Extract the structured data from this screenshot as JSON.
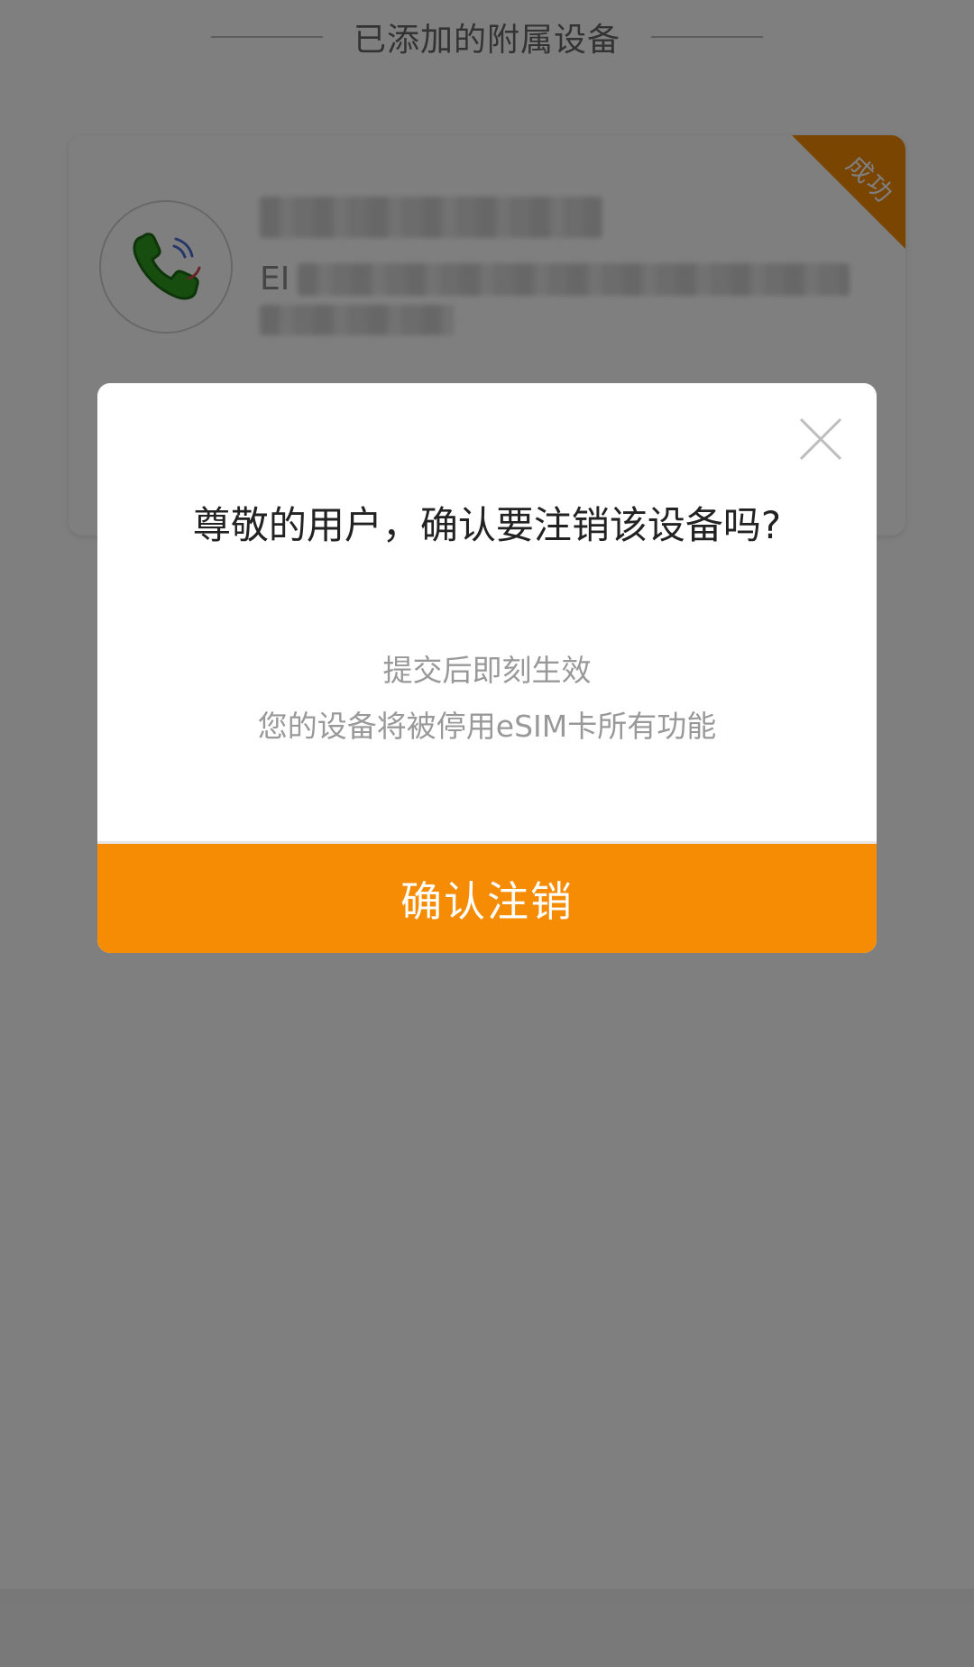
{
  "section": {
    "title": "已添加的附属设备"
  },
  "device_card": {
    "name": "",
    "eid_prefix": "EI",
    "status_badge": "成功"
  },
  "dialog": {
    "title": "尊敬的用户，确认要注销该设备吗?",
    "desc_line1": "提交后即刻生效",
    "desc_line2": "您的设备将被停用eSIM卡所有功能",
    "confirm_label": "确认注销"
  },
  "colors": {
    "accent": "#f68b04",
    "ribbon": "#f28a00",
    "mask": "rgba(0,0,0,0.5)"
  },
  "icons": {
    "device": "phone-call-icon",
    "close": "close-icon"
  }
}
